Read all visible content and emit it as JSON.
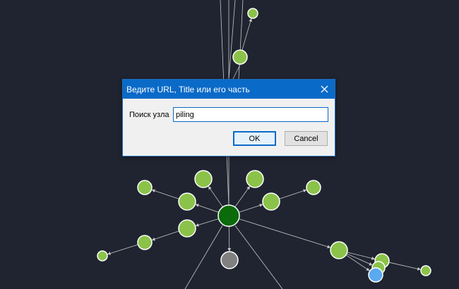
{
  "dialog": {
    "title": "Ведите URL, Title или его часть",
    "close_icon": "close-icon",
    "search_label": "Поиск узла",
    "search_value": "piling",
    "ok_label": "OK",
    "cancel_label": "Cancel"
  },
  "graph": {
    "background": "#1f2430",
    "edge_color": "#c8c8c8",
    "node_colors": {
      "leaf": "#8bc34a",
      "hub": "#0b6b0b",
      "inactive": "#808080",
      "selected": "#5aaaf0"
    }
  }
}
